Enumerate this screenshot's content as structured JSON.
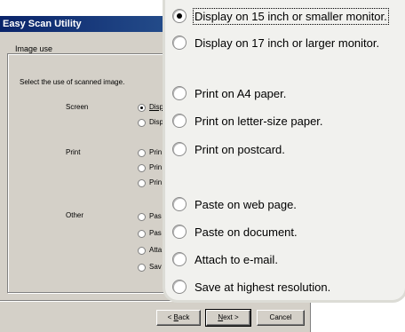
{
  "window": {
    "title": "Easy Scan Utility",
    "group_label": "Image use",
    "instruction": "Select the use of scanned image.",
    "categories": {
      "screen": "Screen",
      "print": "Print",
      "other": "Other"
    },
    "options_truncated": [
      "Disp",
      "Disp",
      "Prin",
      "Prin",
      "Prin",
      "Pas",
      "Pas",
      "Atta",
      "Sav"
    ]
  },
  "buttons": {
    "back": {
      "pre": "< ",
      "ul": "B",
      "post": "ack"
    },
    "next": {
      "ul": "N",
      "post": "ext >"
    },
    "cancel": "Cancel"
  },
  "zoom_options": [
    {
      "label": "Display on 15 inch or smaller monitor.",
      "selected": true
    },
    {
      "label": "Display on 17 inch or larger monitor.",
      "selected": false
    },
    {
      "label": "Print on A4 paper.",
      "selected": false
    },
    {
      "label": "Print on letter-size paper.",
      "selected": false
    },
    {
      "label": "Print on postcard.",
      "selected": false
    },
    {
      "label": "Paste on web page.",
      "selected": false
    },
    {
      "label": "Paste on document.",
      "selected": false
    },
    {
      "label": "Attach to e-mail.",
      "selected": false
    },
    {
      "label": "Save at highest resolution.",
      "selected": false
    }
  ],
  "colors": {
    "titlebar_start": "#0a246a",
    "titlebar_end": "#3a6ea5",
    "dialog_bg": "#d4d0c8",
    "panel_bg": "#f1f1ee"
  }
}
